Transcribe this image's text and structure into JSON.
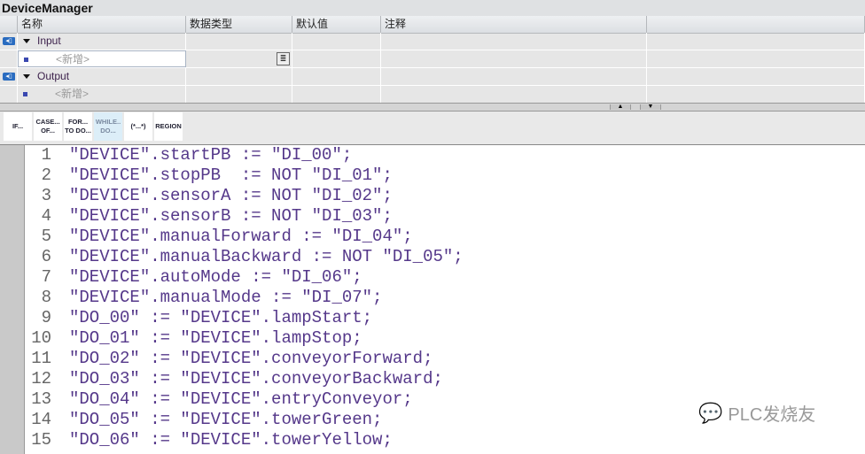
{
  "title": "DeviceManager",
  "columns": [
    "名称",
    "数据类型",
    "默认值",
    "注释"
  ],
  "rows": [
    {
      "name": "Input",
      "kind": "section"
    },
    {
      "name": "<新增>",
      "kind": "add"
    },
    {
      "name": "Output",
      "kind": "section"
    },
    {
      "name": "<新增>",
      "kind": "add"
    }
  ],
  "toolbar": [
    "IF...",
    "CASE... OF...",
    "FOR... TO DO...",
    "WHILE.. DO...",
    "(*...*)",
    "REGION"
  ],
  "code": [
    "\"DEVICE\".startPB := \"DI_00\";",
    "\"DEVICE\".stopPB  := NOT \"DI_01\";",
    "\"DEVICE\".sensorA := NOT \"DI_02\";",
    "\"DEVICE\".sensorB := NOT \"DI_03\";",
    "\"DEVICE\".manualForward := \"DI_04\";",
    "\"DEVICE\".manualBackward := NOT \"DI_05\";",
    "\"DEVICE\".autoMode := \"DI_06\";",
    "\"DEVICE\".manualMode := \"DI_07\";",
    "\"DO_00\" := \"DEVICE\".lampStart;",
    "\"DO_01\" := \"DEVICE\".lampStop;",
    "\"DO_02\" := \"DEVICE\".conveyorForward;",
    "\"DO_03\" := \"DEVICE\".conveyorBackward;",
    "\"DO_04\" := \"DEVICE\".entryConveyor;",
    "\"DO_05\" := \"DEVICE\".towerGreen;",
    "\"DO_06\" := \"DEVICE\".towerYellow;"
  ],
  "watermark": "PLC发烧友"
}
